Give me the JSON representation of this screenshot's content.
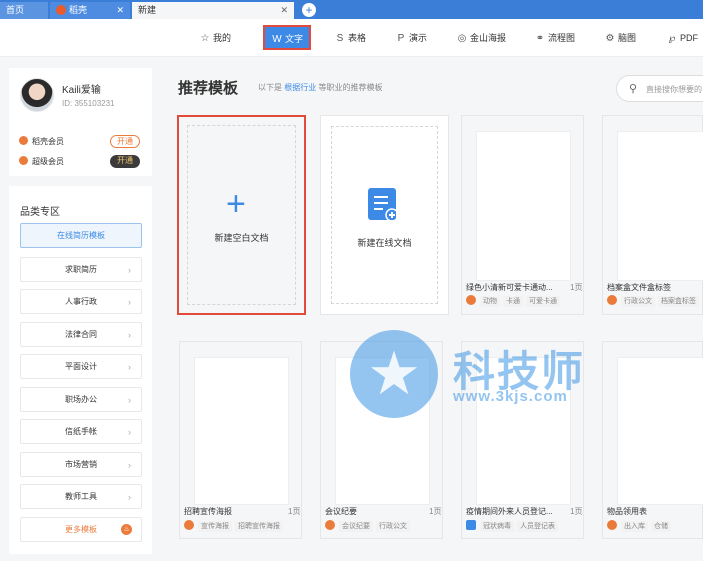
{
  "tabs": [
    {
      "label": "首页"
    },
    {
      "label": "稻壳"
    },
    {
      "label": "新建"
    }
  ],
  "toolbar": {
    "items": [
      {
        "label": "我的",
        "icon": "star-icon"
      },
      {
        "label": "文字",
        "icon": "w-icon"
      },
      {
        "label": "表格",
        "icon": "s-icon"
      },
      {
        "label": "演示",
        "icon": "p-icon"
      },
      {
        "label": "金山海报",
        "icon": "poster-icon"
      },
      {
        "label": "流程图",
        "icon": "flow-icon"
      },
      {
        "label": "脑图",
        "icon": "mindmap-icon"
      },
      {
        "label": "PDF",
        "icon": "pdf-icon"
      }
    ],
    "active": "文字"
  },
  "user": {
    "name": "Kaili爱输",
    "id": "ID: 355103231",
    "memberships": [
      {
        "label": "稻壳会员",
        "button": "开通",
        "color": "#ea7b3b"
      },
      {
        "label": "超级会员",
        "button": "开通",
        "color": "#555555"
      }
    ]
  },
  "categories": {
    "title": "品类专区",
    "items": [
      "在线简历模板",
      "求职简历",
      "人事行政",
      "法律合同",
      "平面设计",
      "职场办公",
      "信纸手帐",
      "市场营销",
      "教师工具",
      "更多模板"
    ]
  },
  "main": {
    "title": "推荐模板",
    "note_prefix": "以下是",
    "note_link": "根据行业",
    "note_suffix": "等职业的推荐模板",
    "search_placeholder": "直接搜你想要的"
  },
  "cards": {
    "blank": {
      "label": "新建空白文档"
    },
    "online": {
      "label": "新建在线文档"
    },
    "templates": [
      {
        "name": "绿色小清新可爱卡通动...",
        "pages": "1页",
        "tags": [
          "动物",
          "卡通",
          "可爱卡通"
        ]
      },
      {
        "name": "档案盒文件盒标签",
        "pages": "",
        "tags": [
          "行政公文",
          "档案盒标签"
        ]
      },
      {
        "name": "招聘宣传海报",
        "pages": "1页",
        "tags": [
          "宣传海报",
          "招聘宣传海报"
        ]
      },
      {
        "name": "会议纪要",
        "pages": "1页",
        "tags": [
          "会议纪要",
          "行政公文"
        ]
      },
      {
        "name": "疫情期间外来人员登记...",
        "pages": "1页",
        "tags": [
          "冠状病毒",
          "人员登记表"
        ]
      },
      {
        "name": "物品领用表",
        "pages": "",
        "tags": [
          "出入库",
          "仓储"
        ]
      }
    ]
  },
  "watermark": {
    "text": "科技师",
    "url": "www.3kjs.com"
  },
  "colors": {
    "accent": "#3c8ae6",
    "highlight": "#e24b3b",
    "orange": "#ea7b3b"
  }
}
